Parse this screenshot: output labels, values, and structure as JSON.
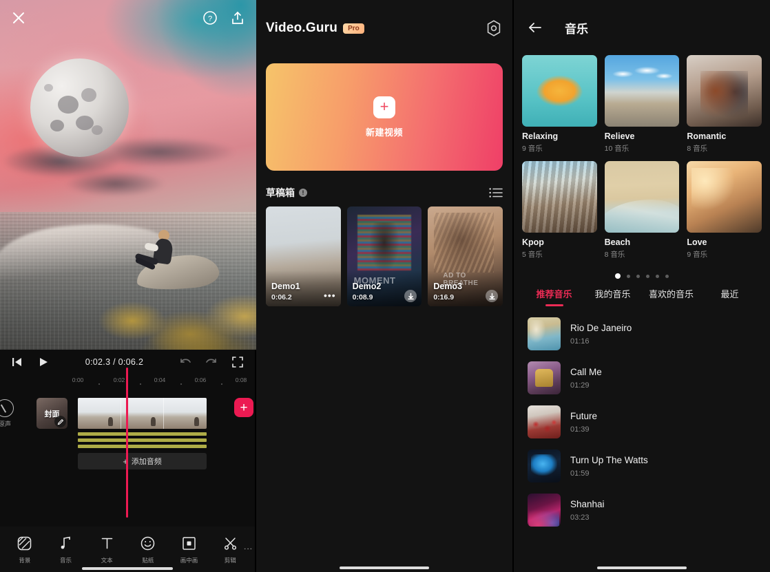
{
  "editor": {
    "top_actions": [
      {
        "name": "close-icon",
        "label": "✕"
      },
      {
        "name": "help-icon",
        "label": "?"
      },
      {
        "name": "export-icon",
        "label": "share"
      }
    ],
    "transport": {
      "skip_start_label": "skip-to-start",
      "play_label": "play",
      "time_readout": "0:02.3 / 0:06.2",
      "undo_label": "undo",
      "redo_label": "redo",
      "fullscreen_label": "fullscreen"
    },
    "ruler_ticks": [
      "0:00",
      "0:02",
      "0:04",
      "0:06",
      "0:08"
    ],
    "timeline": {
      "original_sound_label": "原声",
      "cover_label": "封面",
      "add_audio_label": "添加音频",
      "add_clip_label": "+",
      "playhead_position": "0:02.3"
    },
    "toolbar": [
      {
        "label": "背景",
        "icon": "background-icon"
      },
      {
        "label": "音乐",
        "icon": "music-note-icon"
      },
      {
        "label": "文本",
        "icon": "text-icon"
      },
      {
        "label": "贴纸",
        "icon": "sticker-smiley-icon"
      },
      {
        "label": "画中画",
        "icon": "picture-in-picture-icon"
      },
      {
        "label": "剪辑",
        "icon": "scissors-icon"
      }
    ],
    "toolbar_more": "⋮"
  },
  "home": {
    "logo_text": "Video.Guru",
    "pro_badge": "Pro",
    "settings_icon": "gear-icon",
    "new_video_label": "新建视频",
    "drafts_title": "草稿箱",
    "drafts_info_badge": "!",
    "drafts_list_icon": "list-view-icon",
    "drafts": [
      {
        "name": "Demo1",
        "duration": "0:06.2",
        "action": "more-options",
        "watermark": ""
      },
      {
        "name": "Demo2",
        "duration": "0:08.9",
        "action": "download",
        "watermark": "MOMENT"
      },
      {
        "name": "Demo3",
        "duration": "0:16.9",
        "action": "download",
        "watermark": "AD TO BREATHE"
      }
    ]
  },
  "music": {
    "back_icon": "back-arrow-icon",
    "title": "音乐",
    "categories": [
      {
        "name": "Relaxing",
        "count": "9 音乐",
        "thumb": "th-relaxing"
      },
      {
        "name": "Relieve",
        "count": "10 音乐",
        "thumb": "th-relieve"
      },
      {
        "name": "Romantic",
        "count": "8 音乐",
        "thumb": "th-romantic"
      },
      {
        "name": "Kpop",
        "count": "5 音乐",
        "thumb": "th-kpop"
      },
      {
        "name": "Beach",
        "count": "8 音乐",
        "thumb": "th-beach"
      },
      {
        "name": "Love",
        "count": "9 音乐",
        "thumb": "th-love"
      }
    ],
    "page_dots": {
      "total": 6,
      "active_index": 0
    },
    "tabs": [
      {
        "label": "推荐音乐",
        "active": true
      },
      {
        "label": "我的音乐",
        "active": false
      },
      {
        "label": "喜欢的音乐",
        "active": false
      },
      {
        "label": "最近",
        "active": false
      }
    ],
    "tracks": [
      {
        "title": "Rio De Janeiro",
        "duration": "01:16",
        "thumb": "tt-rio"
      },
      {
        "title": "Call Me",
        "duration": "01:29",
        "thumb": "tt-call"
      },
      {
        "title": "Future",
        "duration": "01:39",
        "thumb": "tt-future"
      },
      {
        "title": "Turn Up The Watts",
        "duration": "01:59",
        "thumb": "tt-watts"
      },
      {
        "title": "Shanhai",
        "duration": "03:23",
        "thumb": "tt-shanhai"
      }
    ]
  },
  "colors": {
    "accent_pink": "#ec2b55",
    "accent_red": "#ec1a52",
    "gradient_start": "#f6c46a",
    "gradient_end": "#ef3f67",
    "waveform": "#aeac47"
  }
}
